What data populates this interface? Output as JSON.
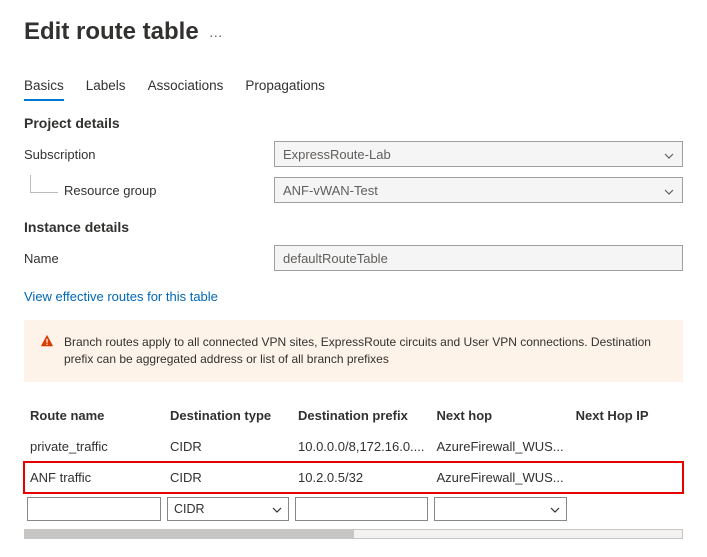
{
  "title": "Edit route table",
  "tabs": [
    "Basics",
    "Labels",
    "Associations",
    "Propagations"
  ],
  "active_tab": 0,
  "sections": {
    "project": {
      "header": "Project details",
      "subscription_label": "Subscription",
      "subscription_value": "ExpressRoute-Lab",
      "resource_group_label": "Resource group",
      "resource_group_value": "ANF-vWAN-Test"
    },
    "instance": {
      "header": "Instance details",
      "name_label": "Name",
      "name_value": "defaultRouteTable"
    }
  },
  "link_text": "View effective routes for this table",
  "warning_text": "Branch routes apply to all connected VPN sites, ExpressRoute circuits and User VPN connections. Destination prefix can be aggregated address or list of all branch prefixes",
  "table": {
    "headers": [
      "Route name",
      "Destination type",
      "Destination prefix",
      "Next hop",
      "Next Hop IP"
    ],
    "rows": [
      {
        "name": "private_traffic",
        "dtype": "CIDR",
        "dpref": "10.0.0.0/8,172.16.0....",
        "nhop": "AzureFirewall_WUS...",
        "nhip": ""
      },
      {
        "name": "ANF traffic",
        "dtype": "CIDR",
        "dpref": "10.2.0.5/32",
        "nhop": "AzureFirewall_WUS...",
        "nhip": "",
        "highlight": true
      }
    ],
    "new_row": {
      "name": "",
      "dtype": "CIDR",
      "dpref": "",
      "nhop": "",
      "nhip": ""
    }
  }
}
